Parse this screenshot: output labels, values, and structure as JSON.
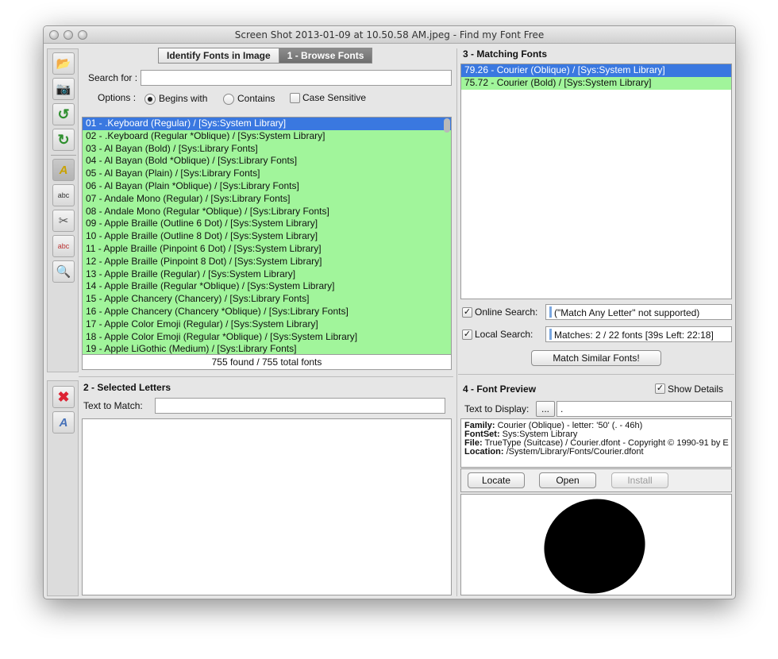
{
  "window": {
    "title": "Screen Shot 2013-01-09 at 10.50.58 AM.jpeg - Find my Font Free"
  },
  "toolbar": {
    "tools": [
      {
        "name": "open-image-icon",
        "glyph": "📂"
      },
      {
        "name": "camera-icon",
        "glyph": "📷"
      },
      {
        "name": "undo-icon",
        "glyph": "↺"
      },
      {
        "name": "redo-icon",
        "glyph": "↻"
      },
      {
        "name": "identify-letters-icon",
        "glyph": "A"
      },
      {
        "name": "abc-tool-icon",
        "glyph": "abc"
      },
      {
        "name": "cut-icon",
        "glyph": "✂"
      },
      {
        "name": "abc-grid-icon",
        "glyph": "abc"
      },
      {
        "name": "magnifier-icon",
        "glyph": "🔍"
      }
    ],
    "bottom_tools": [
      {
        "name": "delete-icon",
        "glyph": "✖"
      },
      {
        "name": "remove-letter-icon",
        "glyph": "A"
      }
    ]
  },
  "tabs": {
    "identify": "Identify Fonts in Image",
    "browse": "1 - Browse Fonts"
  },
  "browse": {
    "search_label": "Search for :",
    "search_value": "",
    "options_label": "Options :",
    "begins_with": "Begins with",
    "contains": "Contains",
    "case_sensitive": "Case Sensitive",
    "fonts": [
      "01 - .Keyboard (Regular) / [Sys:System Library]",
      "02 - .Keyboard (Regular *Oblique) / [Sys:System Library]",
      "03 - Al Bayan (Bold) / [Sys:Library Fonts]",
      "04 - Al Bayan (Bold *Oblique) / [Sys:Library Fonts]",
      "05 - Al Bayan (Plain) / [Sys:Library Fonts]",
      "06 - Al Bayan (Plain *Oblique) / [Sys:Library Fonts]",
      "07 - Andale Mono (Regular) / [Sys:Library Fonts]",
      "08 - Andale Mono (Regular *Oblique) / [Sys:Library Fonts]",
      "09 - Apple Braille (Outline 6 Dot) / [Sys:System Library]",
      "10 - Apple Braille (Outline 8 Dot) / [Sys:System Library]",
      "11 - Apple Braille (Pinpoint 6 Dot) / [Sys:System Library]",
      "12 - Apple Braille (Pinpoint 8 Dot) / [Sys:System Library]",
      "13 - Apple Braille (Regular) / [Sys:System Library]",
      "14 - Apple Braille (Regular *Oblique) / [Sys:System Library]",
      "15 - Apple Chancery (Chancery) / [Sys:Library Fonts]",
      "16 - Apple Chancery (Chancery *Oblique) / [Sys:Library Fonts]",
      "17 - Apple Color Emoji (Regular) / [Sys:System Library]",
      "18 - Apple Color Emoji (Regular *Oblique) / [Sys:System Library]",
      "19 - Apple LiGothic (Medium) / [Sys:Library Fonts]"
    ],
    "found_status": "755 found / 755 total fonts"
  },
  "selected": {
    "title": "2 - Selected Letters",
    "text_label": "Text to Match:",
    "text_value": ""
  },
  "matching": {
    "title": "3 - Matching Fonts",
    "items": [
      "79.26 - Courier (Oblique) / [Sys:System Library]",
      "75.72 - Courier (Bold) / [Sys:System Library]"
    ],
    "online_label": "Online Search:",
    "online_value": "(\"Match Any Letter\" not supported)",
    "local_label": "Local Search:",
    "local_value": "Matches: 2 / 22 fonts [39s Left: 22:18]",
    "match_button": "Match Similar Fonts!"
  },
  "preview": {
    "title": "4 - Font Preview",
    "show_details": "Show Details",
    "text_label": "Text to Display:",
    "ellipsis_button": "...",
    "text_value": ".",
    "family_key": "Family:",
    "family_val": "Courier (Oblique) - letter: '50' (. - 46h)",
    "fontset_key": "FontSet:",
    "fontset_val": "Sys:System Library",
    "file_key": "File:",
    "file_val": "TrueType (Suitcase) / Courier.dfont  - Copyright © 1990-91 by E",
    "location_key": "Location:",
    "location_val": "/System/Library/Fonts/Courier.dfont",
    "locate": "Locate",
    "open": "Open",
    "install": "Install"
  }
}
